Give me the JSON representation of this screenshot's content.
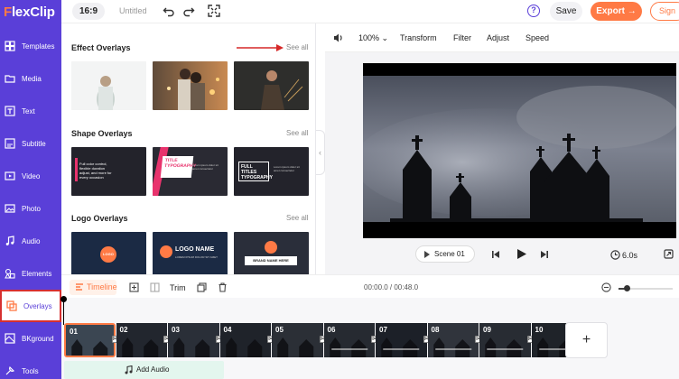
{
  "brand": {
    "name_prefix": "F",
    "name_rest": "lexClip",
    "accent": "#5a3fd8",
    "orange": "#ff7a45"
  },
  "sidebar": {
    "items": [
      {
        "label": "Templates",
        "icon": "grid-icon"
      },
      {
        "label": "Media",
        "icon": "folder-icon"
      },
      {
        "label": "Text",
        "icon": "text-icon"
      },
      {
        "label": "Subtitle",
        "icon": "subtitle-icon"
      },
      {
        "label": "Video",
        "icon": "video-icon"
      },
      {
        "label": "Photo",
        "icon": "photo-icon"
      },
      {
        "label": "Audio",
        "icon": "music-icon"
      },
      {
        "label": "Elements",
        "icon": "elements-icon"
      },
      {
        "label": "Overlays",
        "icon": "overlays-icon",
        "active": true
      },
      {
        "label": "BKground",
        "icon": "background-icon"
      },
      {
        "label": "Tools",
        "icon": "tools-icon"
      }
    ]
  },
  "topbar": {
    "ratio": "16:9",
    "title": "Untitled",
    "help": "?",
    "save": "Save",
    "export": "Export →",
    "signin": "Sign"
  },
  "panel": {
    "sections": [
      {
        "title": "Effect Overlays",
        "see_all": "See all"
      },
      {
        "title": "Shape Overlays",
        "see_all": "See all"
      },
      {
        "title": "Logo Overlays",
        "see_all": "See all"
      }
    ],
    "shape_thumbs": [
      {
        "text": "Full color control, flexible duration adjust, and more for every occasion"
      },
      {
        "title_lines": [
          "TITLE",
          "TYPOGRAPHY"
        ],
        "body": "Lorem ipsum dolor sit amet consectetur"
      },
      {
        "title_lines": [
          "FULL TITLES",
          "TYPOGRAPHY"
        ],
        "body": "Lorem ipsum dolor sit amet consectetur"
      }
    ],
    "logo_thumbs": [
      {
        "logo": "LOGO",
        "name": ""
      },
      {
        "logo": "",
        "name": "LOGO NAME",
        "sub": "LOREM IPSUM DOLOR SIT AMET"
      },
      {
        "logo": "",
        "name": "BRAND NAME HERE"
      }
    ],
    "collapse": "‹"
  },
  "edit_toolbar": {
    "zoom": "100%",
    "items": [
      "Transform",
      "Filter",
      "Adjust",
      "Speed"
    ]
  },
  "player": {
    "scene": "Scene 01",
    "duration": "6.0s"
  },
  "timeline": {
    "button": "Timeline",
    "trim": "Trim",
    "time": "00:00.0 / 00:48.0",
    "zoom_level": 0.15,
    "clips": [
      "01",
      "02",
      "03",
      "04",
      "05",
      "06",
      "07",
      "08",
      "09",
      "10"
    ],
    "add_audio": "Add Audio",
    "add_scene": "+"
  }
}
